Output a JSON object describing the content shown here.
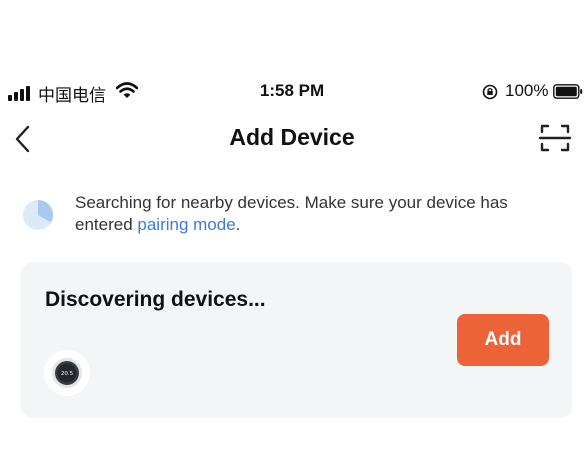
{
  "status_bar": {
    "carrier": "中国电信",
    "time": "1:58 PM",
    "battery": "100%",
    "icons": [
      "signal-icon",
      "wifi-icon",
      "orientation-lock-icon",
      "battery-icon"
    ]
  },
  "nav": {
    "title": "Add Device",
    "back_icon": "chevron-left-icon",
    "scan_icon": "scan-icon"
  },
  "info": {
    "text_before": "Searching for nearby devices. Make sure your device has entered ",
    "link": "pairing mode",
    "text_after": ".",
    "link_color": "#3d7bd9"
  },
  "discovery": {
    "title": "Discovering devices...",
    "add_label": "Add",
    "add_color": "#eb6337",
    "device_icon": "thermostat-icon",
    "device_reading": "20.5"
  }
}
